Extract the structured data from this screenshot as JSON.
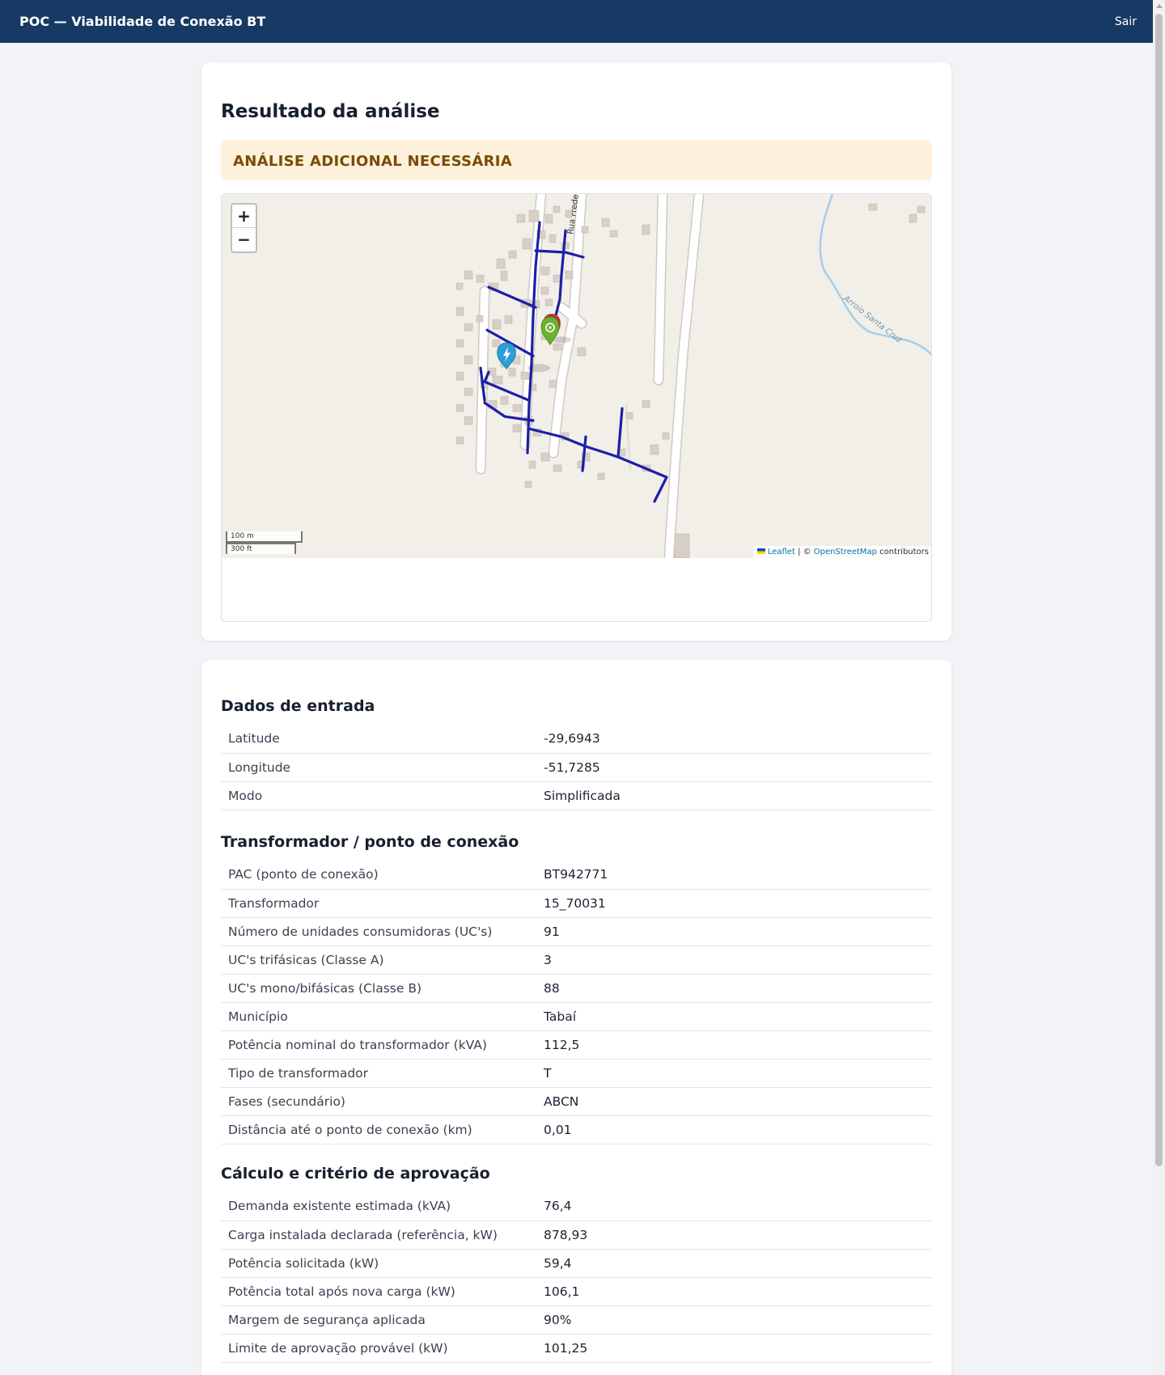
{
  "header": {
    "title": "POC — Viabilidade de Conexão BT",
    "logout": "Sair"
  },
  "result": {
    "heading": "Resultado da análise",
    "status": "ANÁLISE ADICIONAL NECESSÁRIA",
    "status_color": "#7a4b06",
    "status_bg": "#fdf1dc"
  },
  "map": {
    "zoom_in": "+",
    "zoom_out": "−",
    "scale_metric": "100 m",
    "scale_imperial": "300 ft",
    "attribution_leaflet": "Leaflet",
    "attribution_sep": " | © ",
    "attribution_osm": "OpenStreetMap",
    "attribution_tail": " contributors",
    "street_label": "Rua Freder",
    "river_label": "Arroio Santa Cruz",
    "network_color": "#1c1fa8",
    "markers": [
      "transformer-marker-icon",
      "requested-point-marker-icon"
    ]
  },
  "input": {
    "heading": "Dados de entrada",
    "rows": [
      {
        "label": "Latitude",
        "value": "-29,6943"
      },
      {
        "label": "Longitude",
        "value": "-51,7285"
      },
      {
        "label": "Modo",
        "value": "Simplificada"
      }
    ]
  },
  "transformer": {
    "heading": "Transformador / ponto de conexão",
    "rows": [
      {
        "label": "PAC (ponto de conexão)",
        "value": "BT942771"
      },
      {
        "label": "Transformador",
        "value": "15_70031"
      },
      {
        "label": "Número de unidades consumidoras (UC's)",
        "value": "91"
      },
      {
        "label": "UC's trifásicas (Classe A)",
        "value": "3"
      },
      {
        "label": "UC's mono/bifásicas (Classe B)",
        "value": "88"
      },
      {
        "label": "Município",
        "value": "Tabaí"
      },
      {
        "label": "Potência nominal do transformador (kVA)",
        "value": "112,5"
      },
      {
        "label": "Tipo de transformador",
        "value": "T"
      },
      {
        "label": "Fases (secundário)",
        "value": "ABCN"
      },
      {
        "label": "Distância até o ponto de conexão (km)",
        "value": "0,01"
      }
    ]
  },
  "calc": {
    "heading": "Cálculo e critério de aprovação",
    "rows": [
      {
        "label": "Demanda existente estimada (kVA)",
        "value": "76,4"
      },
      {
        "label": "Carga instalada declarada (referência, kW)",
        "value": "878,93"
      },
      {
        "label": "Potência solicitada (kW)",
        "value": "59,4"
      },
      {
        "label": "Potência total após nova carga (kW)",
        "value": "106,1"
      },
      {
        "label": "Margem de segurança aplicada",
        "value": "90%"
      },
      {
        "label": "Limite de aprovação provável (kW)",
        "value": "101,25"
      }
    ]
  }
}
